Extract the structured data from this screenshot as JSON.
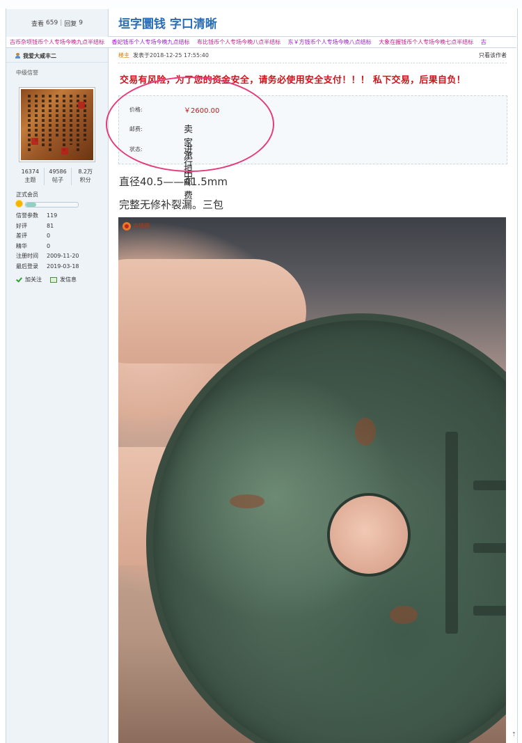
{
  "thread": {
    "views_label": "查看",
    "views": "659",
    "replies_label": "回复",
    "replies": "9",
    "title": "垣字圜钱  字口清晰"
  },
  "ticker": [
    "古币杂项钱币个人专场今晚九点半结标",
    "香妃钱币个人专场今晚九点结标",
    "布比钱币个人专场今晚八点半结标",
    "东￥方钱币个人专场今晚八点结标",
    "大象在握钱币个人专场今晚七点半结标",
    "古"
  ],
  "author": {
    "name": "我爱大咸丰二",
    "rank": "中级信誉",
    "stats": [
      {
        "value": "16374",
        "label": "主题"
      },
      {
        "value": "49586",
        "label": "帖子"
      },
      {
        "value": "8.2万",
        "label": "积分"
      }
    ],
    "member_type": "正式会员",
    "rank_progress": 0.2,
    "info": [
      {
        "key": "信誉参数",
        "value": "119"
      },
      {
        "key": "好评",
        "value": "81"
      },
      {
        "key": "差评",
        "value": "0"
      },
      {
        "key": "精华",
        "value": "0"
      },
      {
        "key": "注册时间",
        "value": "2009-11-20"
      },
      {
        "key": "最后登录",
        "value": "2019-03-18"
      }
    ],
    "follow_label": "加关注",
    "message_label": "发信息"
  },
  "post": {
    "owner_label": "楼主",
    "posted_at": "发表于2018-12-25 17:55:40",
    "only_author": "只看该作者",
    "warning": "交易有风险，为了您的资金安全，请务必使用安全支付！！！ 私下交易，后果自负！",
    "trade": {
      "price_label": "价格:",
      "price": "￥2600.00",
      "shipping_label": "邮费:",
      "shipping": "卖家承担邮费",
      "status_label": "状态:",
      "status": "进行中"
    },
    "desc_line1": "直径40.5——41.5mm",
    "desc_line2": "完整无修补裂漏。三包",
    "photo_logo": "古钱网"
  },
  "colors": {
    "title_blue": "#2a6db5",
    "warning_red": "#d0121b",
    "circle_pink": "#e63b79"
  }
}
